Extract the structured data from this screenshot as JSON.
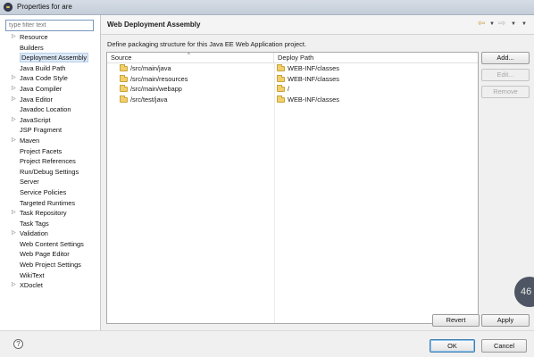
{
  "window": {
    "title": "Properties for are"
  },
  "filter": {
    "placeholder": "type filter text"
  },
  "nav_tree": {
    "items": [
      {
        "label": "Resource",
        "expandable": true
      },
      {
        "label": "Builders",
        "expandable": false
      },
      {
        "label": "Deployment Assembly",
        "expandable": false,
        "selected": true
      },
      {
        "label": "Java Build Path",
        "expandable": false
      },
      {
        "label": "Java Code Style",
        "expandable": true
      },
      {
        "label": "Java Compiler",
        "expandable": true
      },
      {
        "label": "Java Editor",
        "expandable": true
      },
      {
        "label": "Javadoc Location",
        "expandable": false
      },
      {
        "label": "JavaScript",
        "expandable": true
      },
      {
        "label": "JSP Fragment",
        "expandable": false
      },
      {
        "label": "Maven",
        "expandable": true
      },
      {
        "label": "Project Facets",
        "expandable": false
      },
      {
        "label": "Project References",
        "expandable": false
      },
      {
        "label": "Run/Debug Settings",
        "expandable": false
      },
      {
        "label": "Server",
        "expandable": false
      },
      {
        "label": "Service Policies",
        "expandable": false
      },
      {
        "label": "Targeted Runtimes",
        "expandable": false
      },
      {
        "label": "Task Repository",
        "expandable": true
      },
      {
        "label": "Task Tags",
        "expandable": false
      },
      {
        "label": "Validation",
        "expandable": true
      },
      {
        "label": "Web Content Settings",
        "expandable": false
      },
      {
        "label": "Web Page Editor",
        "expandable": false
      },
      {
        "label": "Web Project Settings",
        "expandable": false
      },
      {
        "label": "WikiText",
        "expandable": false
      },
      {
        "label": "XDoclet",
        "expandable": true
      }
    ]
  },
  "page": {
    "title": "Web Deployment Assembly",
    "description": "Define packaging structure for this Java EE Web Application project."
  },
  "table": {
    "columns": {
      "source": "Source",
      "deploy_path": "Deploy Path"
    },
    "rows": [
      {
        "source": "/src/main/java",
        "deploy": "WEB-INF/classes"
      },
      {
        "source": "/src/main/resources",
        "deploy": "WEB-INF/classes"
      },
      {
        "source": "/src/main/webapp",
        "deploy": "/"
      },
      {
        "source": "/src/test/java",
        "deploy": "WEB-INF/classes"
      }
    ]
  },
  "side_buttons": {
    "add": "Add...",
    "edit": "Edit...",
    "remove": "Remove"
  },
  "bottom_buttons": {
    "revert": "Revert",
    "apply": "Apply"
  },
  "footer": {
    "help": "?",
    "ok": "OK",
    "cancel": "Cancel"
  },
  "overlay_badge": "46",
  "icons": {
    "app": "eclipse-icon",
    "back": "back-arrow-icon",
    "forward": "forward-arrow-icon",
    "menu": "view-menu-icon",
    "folder": "folder-icon",
    "help": "help-icon"
  }
}
